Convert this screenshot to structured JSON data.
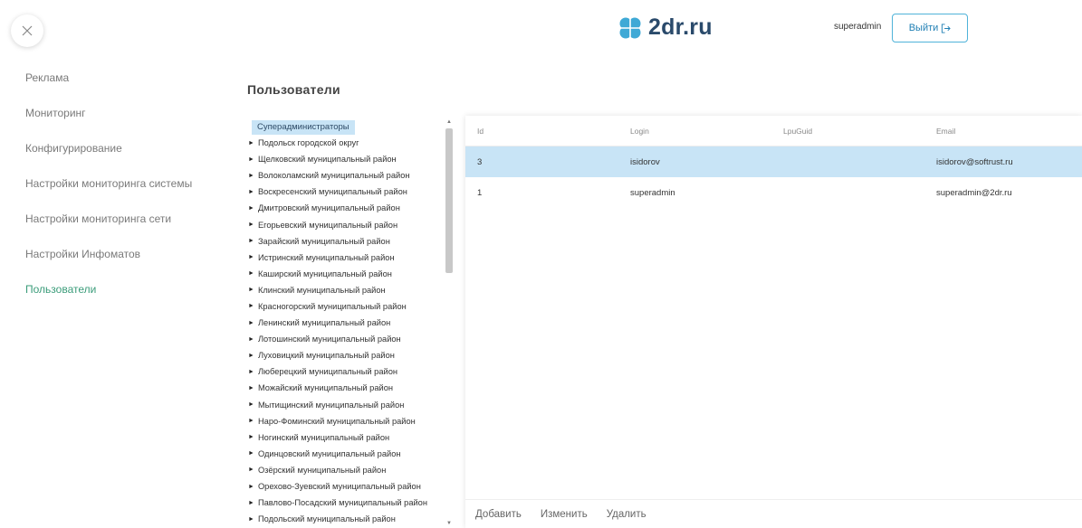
{
  "header": {
    "brand": "2dr.ru",
    "username": "superadmin",
    "logout_label": "Выйти",
    "accent_color": "#4fb3d9"
  },
  "sidebar": {
    "items": [
      {
        "label": "Реклама"
      },
      {
        "label": "Мониторинг"
      },
      {
        "label": "Конфигурирование"
      },
      {
        "label": "Настройки мониторинга системы"
      },
      {
        "label": "Настройки мониторинга сети"
      },
      {
        "label": "Настройки Инфоматов"
      },
      {
        "label": "Пользователи",
        "active": true
      }
    ],
    "active_color": "#3b9c7a"
  },
  "page": {
    "title": "Пользователи"
  },
  "tree": {
    "root": "Суперадминистраторы",
    "items": [
      "Подольск городской округ",
      "Щелковский муниципальный район",
      "Волоколамский муниципальный район",
      "Воскресенский муниципальный район",
      "Дмитровский муниципальный район",
      "Егорьевский муниципальный район",
      "Зарайский муниципальный район",
      "Истринский муниципальный район",
      "Каширский муниципальный район",
      "Клинский муниципальный район",
      "Красногорский муниципальный район",
      "Ленинский муниципальный район",
      "Лотошинский муниципальный район",
      "Луховицкий муниципальный район",
      "Люберецкий муниципальный район",
      "Можайский муниципальный район",
      "Мытищинский муниципальный район",
      "Наро-Фоминский муниципальный район",
      "Ногинский муниципальный район",
      "Одинцовский муниципальный район",
      "Озёрский муниципальный район",
      "Орехово-Зуевский муниципальный район",
      "Павлово-Посадский муниципальный район",
      "Подольский муниципальный район"
    ]
  },
  "table": {
    "columns": [
      "Id",
      "Login",
      "LpuGuid",
      "Email"
    ],
    "rows": [
      {
        "id": "3",
        "login": "isidorov",
        "lpu": "",
        "email": "isidorov@softrust.ru",
        "selected": true
      },
      {
        "id": "1",
        "login": "superadmin",
        "lpu": "",
        "email": "superadmin@2dr.ru",
        "selected": false
      }
    ],
    "selected_color": "#c8e4f6"
  },
  "actions": {
    "add": "Добавить",
    "edit": "Изменить",
    "delete": "Удалить"
  }
}
